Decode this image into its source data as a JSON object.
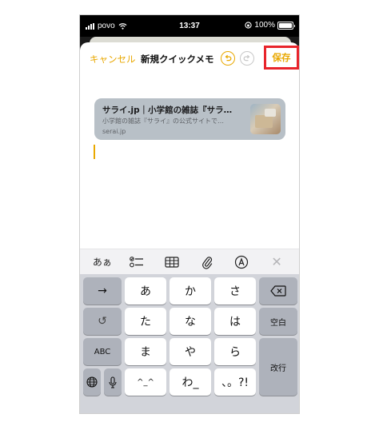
{
  "status_bar": {
    "carrier": "povo",
    "time": "13:37",
    "battery": "100%",
    "battery_level": 1.0
  },
  "nav": {
    "cancel_label": "キャンセル",
    "title": "新規クイックメモ",
    "save_label": "保存"
  },
  "link_card": {
    "title": "サライ.jp｜小学館の雑誌『サラ…",
    "description": "小学館の雑誌『サライ』の公式サイトで…",
    "domain": "serai.jp"
  },
  "toolbar": {
    "text_style_label": "あぁ",
    "icons": [
      "checklist-icon",
      "table-icon",
      "paperclip-icon",
      "markup-icon",
      "close-icon"
    ]
  },
  "keyboard": {
    "row1": [
      "→",
      "あ",
      "か",
      "さ"
    ],
    "row2": [
      "↺",
      "た",
      "な",
      "は"
    ],
    "row3": [
      "ABC",
      "ま",
      "や",
      "ら"
    ],
    "row4": [
      "^_^",
      "わ_",
      "、。?!"
    ],
    "space_label": "空白",
    "return_label": "改行"
  },
  "colors": {
    "accent": "#e9a800",
    "highlight_box": "#e8242b",
    "keyboard_bg": "#d2d4da",
    "function_key": "#aeb2bb",
    "link_card_bg": "#b8c0c7"
  }
}
